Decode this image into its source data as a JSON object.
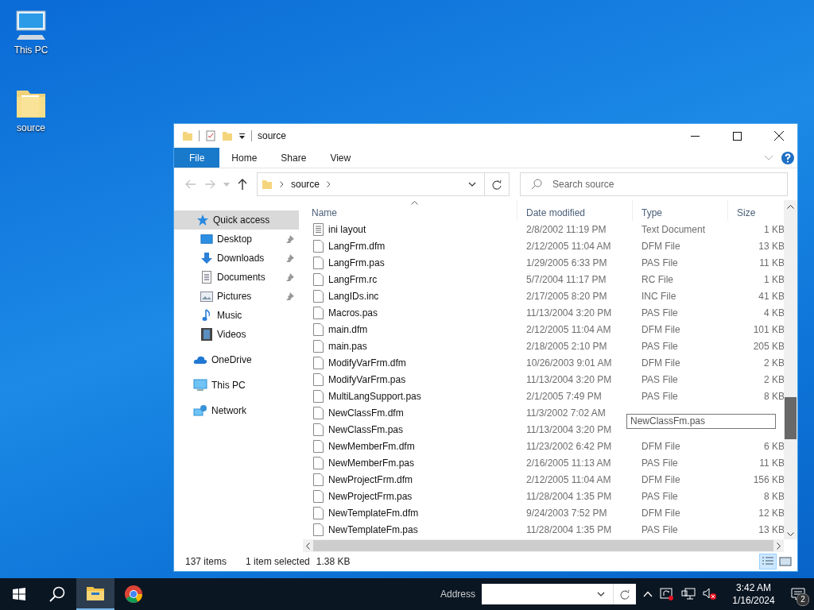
{
  "desktop": {
    "icons": [
      {
        "kind": "pc",
        "label": "This PC"
      },
      {
        "kind": "folder",
        "label": "source"
      }
    ]
  },
  "window": {
    "title": "source",
    "ribbon_tabs": [
      {
        "label": "File",
        "selected": true
      },
      {
        "label": "Home",
        "selected": false
      },
      {
        "label": "Share",
        "selected": false
      },
      {
        "label": "View",
        "selected": false
      }
    ],
    "address": {
      "path": "source"
    },
    "search": {
      "placeholder": "Search source"
    },
    "sidebar": {
      "items": [
        {
          "kind": "star",
          "label": "Quick access",
          "selected": true,
          "children": [
            {
              "kind": "desktop",
              "label": "Desktop",
              "pinned": true
            },
            {
              "kind": "download",
              "label": "Downloads",
              "pinned": true
            },
            {
              "kind": "documents",
              "label": "Documents",
              "pinned": true
            },
            {
              "kind": "pictures",
              "label": "Pictures",
              "pinned": true
            },
            {
              "kind": "music",
              "label": "Music",
              "pinned": false
            },
            {
              "kind": "videos",
              "label": "Videos",
              "pinned": false
            }
          ]
        },
        {
          "kind": "cloud",
          "label": "OneDrive",
          "selected": false
        },
        {
          "kind": "pc",
          "label": "This PC",
          "selected": false
        },
        {
          "kind": "network",
          "label": "Network",
          "selected": false
        }
      ]
    },
    "table": {
      "columns": [
        "Name",
        "Date modified",
        "Type",
        "Size"
      ],
      "rows": [
        {
          "kind": "text",
          "name": "ini layout",
          "date": "2/8/2002 11:19 PM",
          "type": "Text Document",
          "size": "1 KB"
        },
        {
          "kind": "file",
          "name": "LangFrm.dfm",
          "date": "2/12/2005 11:04 AM",
          "type": "DFM File",
          "size": "13 KB"
        },
        {
          "kind": "file",
          "name": "LangFrm.pas",
          "date": "1/29/2005 6:33 PM",
          "type": "PAS File",
          "size": "11 KB"
        },
        {
          "kind": "file",
          "name": "LangFrm.rc",
          "date": "5/7/2004 11:17 PM",
          "type": "RC File",
          "size": "1 KB"
        },
        {
          "kind": "file",
          "name": "LangIDs.inc",
          "date": "2/17/2005 8:20 PM",
          "type": "INC File",
          "size": "41 KB"
        },
        {
          "kind": "file",
          "name": "Macros.pas",
          "date": "11/13/2004 3:20 PM",
          "type": "PAS File",
          "size": "4 KB"
        },
        {
          "kind": "file",
          "name": "main.dfm",
          "date": "2/12/2005 11:04 AM",
          "type": "DFM File",
          "size": "101 KB"
        },
        {
          "kind": "file",
          "name": "main.pas",
          "date": "2/18/2005 2:10 PM",
          "type": "PAS File",
          "size": "205 KB"
        },
        {
          "kind": "file",
          "name": "ModifyVarFrm.dfm",
          "date": "10/26/2003 9:01 AM",
          "type": "DFM File",
          "size": "2 KB"
        },
        {
          "kind": "file",
          "name": "ModifyVarFrm.pas",
          "date": "11/13/2004 3:20 PM",
          "type": "PAS File",
          "size": "2 KB"
        },
        {
          "kind": "file",
          "name": "MultiLangSupport.pas",
          "date": "2/1/2005 7:49 PM",
          "type": "PAS File",
          "size": "8 KB"
        },
        {
          "kind": "file",
          "name": "NewClassFm.dfm",
          "date": "11/3/2002 7:02 AM"
        },
        {
          "kind": "file",
          "name": "NewClassFm.pas",
          "date": "11/13/2004 3:20 PM"
        },
        {
          "kind": "file",
          "name": "NewMemberFm.dfm",
          "date": "11/23/2002 6:42 PM",
          "type": "DFM File",
          "size": "6 KB"
        },
        {
          "kind": "file",
          "name": "NewMemberFm.pas",
          "date": "2/16/2005 11:13 AM",
          "type": "PAS File",
          "size": "11 KB"
        },
        {
          "kind": "file",
          "name": "NewProjectFrm.dfm",
          "date": "2/12/2005 11:04 AM",
          "type": "DFM File",
          "size": "156 KB"
        },
        {
          "kind": "file",
          "name": "NewProjectFrm.pas",
          "date": "11/28/2004 1:35 PM",
          "type": "PAS File",
          "size": "8 KB"
        },
        {
          "kind": "file",
          "name": "NewTemplateFm.dfm",
          "date": "9/24/2003 7:52 PM",
          "type": "DFM File",
          "size": "12 KB"
        },
        {
          "kind": "file",
          "name": "NewTemplateFm.pas",
          "date": "11/28/2004 1:35 PM",
          "type": "PAS File",
          "size": "13 KB"
        }
      ]
    },
    "tooltip": "NewClassFm.pas",
    "status_bar": {
      "item_count": "137 items",
      "selection": "1 item selected",
      "selection_size": "1.38 KB"
    }
  },
  "taskbar": {
    "apps": [
      {
        "kind": "explorer",
        "active": true
      },
      {
        "kind": "chrome",
        "active": false
      }
    ],
    "address_label": "Address",
    "time": "3:42 AM",
    "date": "1/16/2024",
    "notification_count": "2"
  }
}
